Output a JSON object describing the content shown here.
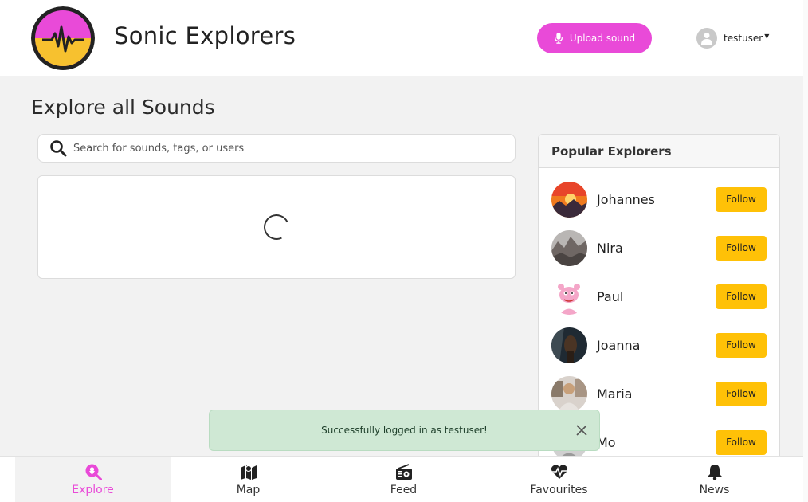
{
  "header": {
    "brand_name": "Sonic Explorers",
    "upload_label": "Upload sound",
    "username": "testuser"
  },
  "main": {
    "title": "Explore all Sounds",
    "search_placeholder": "Search for sounds, tags, or users"
  },
  "popular": {
    "title": "Popular Explorers",
    "follow_label": "Follow",
    "explorers": [
      {
        "name": "Johannes"
      },
      {
        "name": "Nira"
      },
      {
        "name": "Paul"
      },
      {
        "name": "Joanna"
      },
      {
        "name": "Maria"
      },
      {
        "name": "Mo"
      }
    ]
  },
  "toast": {
    "message": "Successfully logged in as testuser!"
  },
  "bottom_nav": {
    "items": [
      {
        "label": "Explore",
        "icon": "search-location-icon",
        "active": true
      },
      {
        "label": "Map",
        "icon": "map-icon",
        "active": false
      },
      {
        "label": "Feed",
        "icon": "radio-icon",
        "active": false
      },
      {
        "label": "Favourites",
        "icon": "heartbeat-icon",
        "active": false
      },
      {
        "label": "News",
        "icon": "bell-icon",
        "active": false
      }
    ]
  },
  "colors": {
    "accent": "#e94ad8",
    "follow": "#ffc107",
    "toast_bg": "#cfe8d4"
  }
}
